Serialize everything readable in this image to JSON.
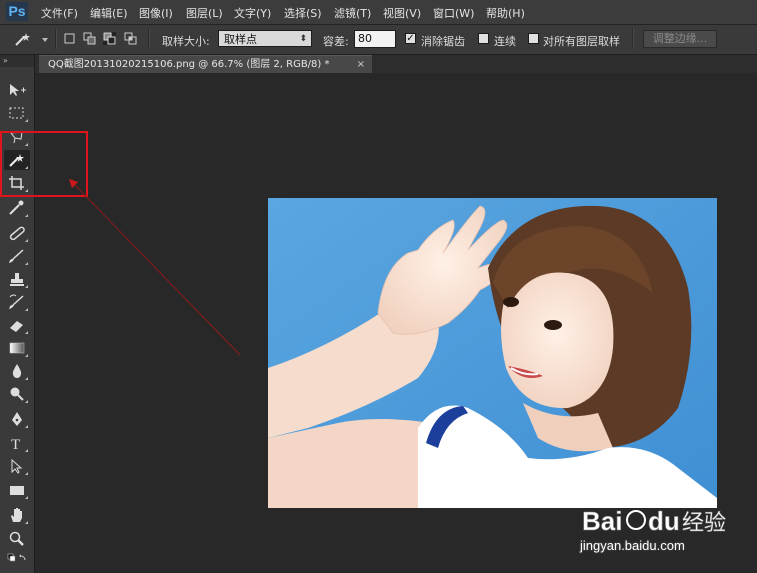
{
  "app": {
    "logo": "Ps"
  },
  "menu": [
    "文件(F)",
    "编辑(E)",
    "图像(I)",
    "图层(L)",
    "文字(Y)",
    "选择(S)",
    "滤镜(T)",
    "视图(V)",
    "窗口(W)",
    "帮助(H)"
  ],
  "options": {
    "sample_size_label": "取样大小:",
    "sample_size_value": "取样点",
    "tolerance_label": "容差:",
    "tolerance_value": "80",
    "antialias_label": "消除锯齿",
    "antialias_checked": true,
    "contiguous_label": "连续",
    "contiguous_checked": false,
    "all_layers_label": "对所有图层取样",
    "all_layers_checked": false,
    "refine_edge_label": "调整边缘..."
  },
  "document_tab": {
    "title": "QQ截图20131020215106.png @ 66.7% (图层 2, RGB/8) *",
    "close": "×"
  },
  "toolbar": {
    "collapse": "»",
    "tools": [
      "move-tool",
      "marquee-tool",
      "lasso-tool",
      "magic-wand-tool",
      "crop-tool",
      "eyedropper-tool",
      "healing-brush-tool",
      "brush-tool",
      "clone-stamp-tool",
      "history-brush-tool",
      "eraser-tool",
      "gradient-tool",
      "blur-tool",
      "dodge-tool",
      "pen-tool",
      "type-tool",
      "path-selection-tool",
      "rectangle-tool",
      "hand-tool",
      "zoom-tool"
    ],
    "active_tool": "magic-wand-tool"
  },
  "annotation": {
    "highlight_color": "#e0141c"
  },
  "watermark": {
    "url": "jingyan.baidu.com",
    "brand": "Bai",
    "brand_suffix": "du",
    "cn": "经验"
  }
}
